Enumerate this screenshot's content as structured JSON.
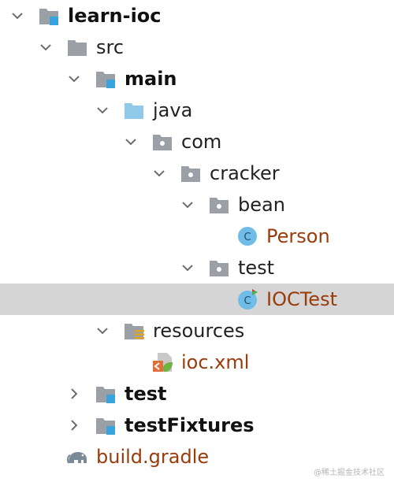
{
  "tree": {
    "root": "learn-ioc",
    "src": "src",
    "main": "main",
    "java": "java",
    "com": "com",
    "cracker": "cracker",
    "bean": "bean",
    "person": "Person",
    "test_pkg": "test",
    "ioctest": "IOCTest",
    "resources": "resources",
    "iocxml": "ioc.xml",
    "test_dir": "test",
    "testfixtures": "testFixtures",
    "build_gradle": "build.gradle"
  },
  "class_icon_letter": "C",
  "watermark": "@稀土掘金技术社区",
  "colors": {
    "selected_row": "#d5d5d5",
    "folder_gray": "#9aa0a6",
    "module_blue": "#39a3dd",
    "source_folder_blue": "#8fcbe8",
    "file_name_brown": "#9a3b0b",
    "class_icon_bg": "#6fbde6"
  }
}
